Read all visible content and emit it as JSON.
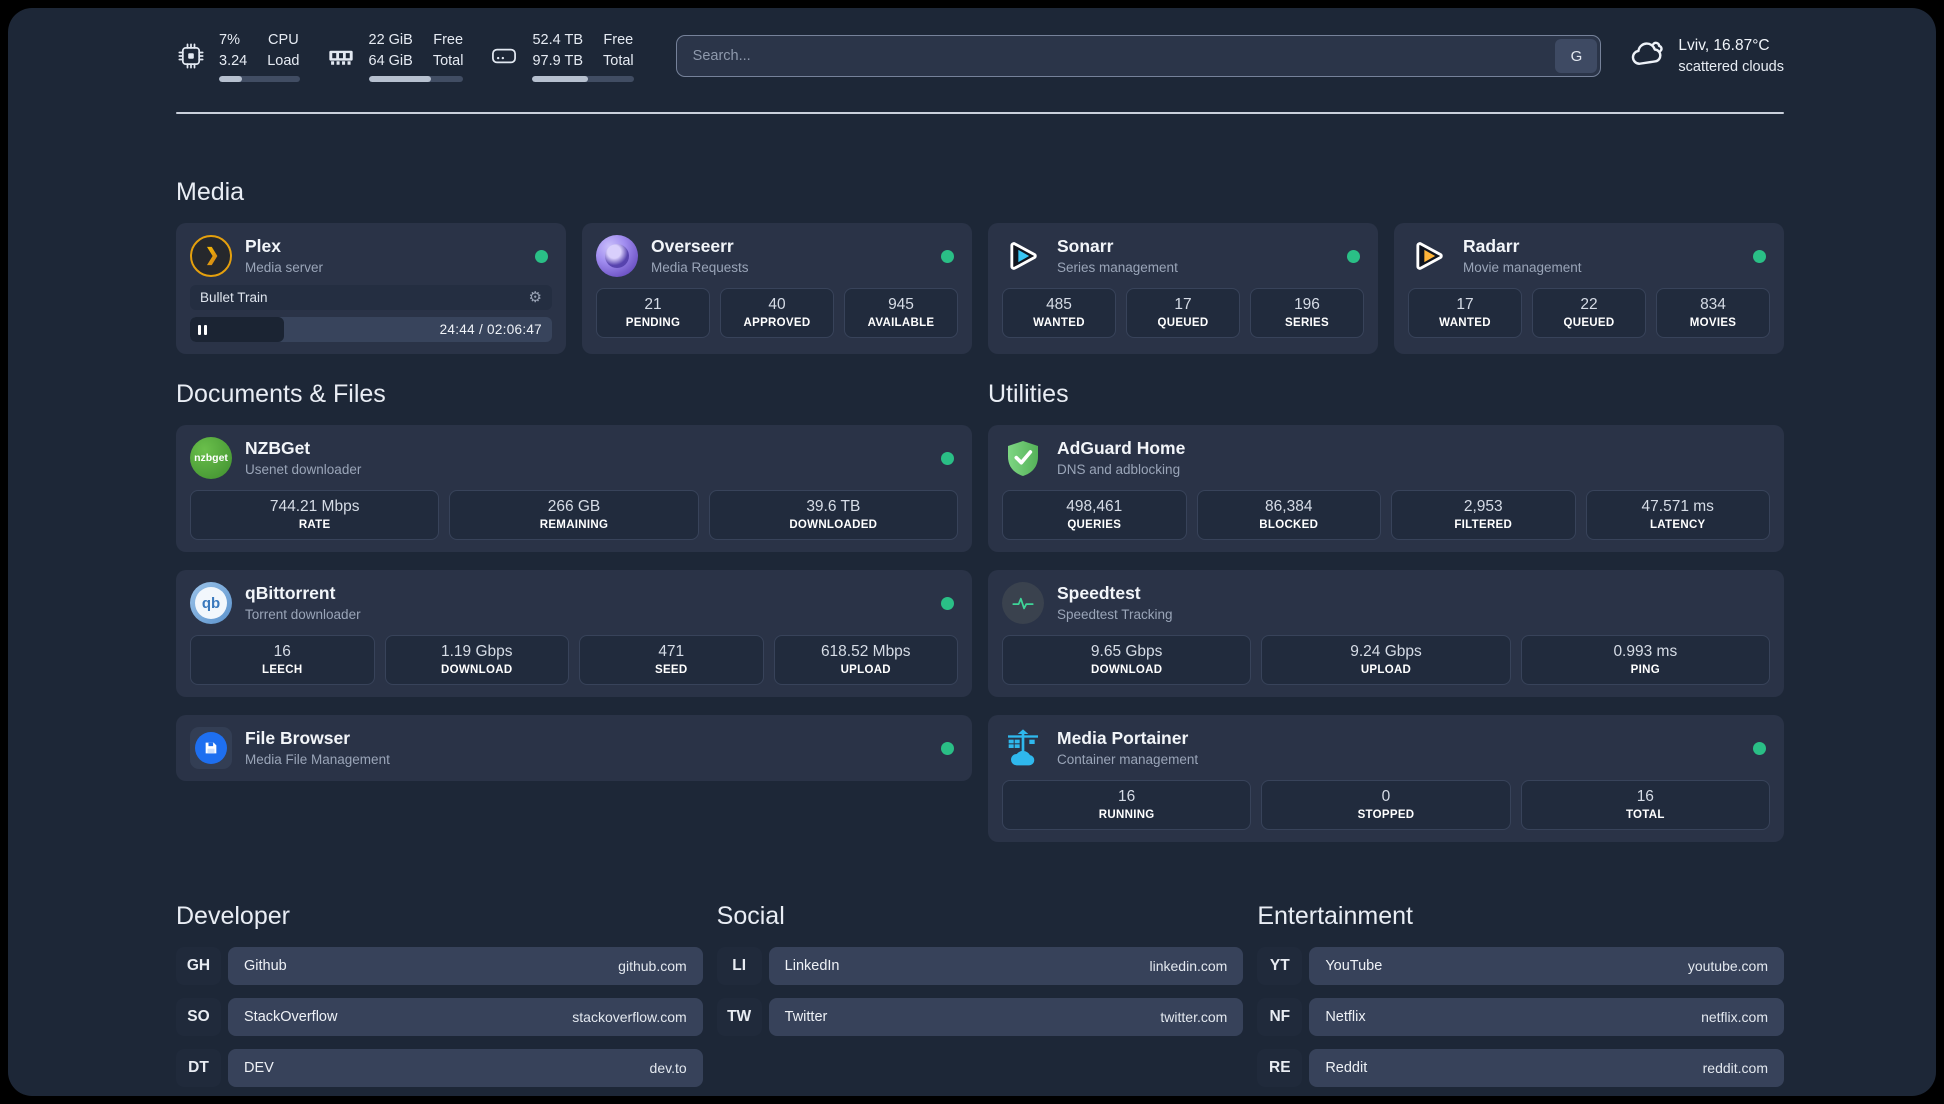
{
  "topbar": {
    "system": [
      {
        "name": "cpu",
        "value_top": "7%",
        "value_bottom": "3.24",
        "label_top": "CPU",
        "label_bottom": "Load",
        "progress": 28
      },
      {
        "name": "memory",
        "value_top": "22 GiB",
        "value_bottom": "64 GiB",
        "label_top": "Free",
        "label_bottom": "Total",
        "progress": 66
      },
      {
        "name": "storage",
        "value_top": "52.4 TB",
        "value_bottom": "97.9 TB",
        "label_top": "Free",
        "label_bottom": "Total",
        "progress": 55
      }
    ],
    "search": {
      "placeholder": "Search...",
      "button_label": "G"
    },
    "weather": {
      "location": "Lviv, 16.87°C",
      "condition": "scattered clouds"
    }
  },
  "sections": {
    "media": {
      "title": "Media",
      "plex": {
        "title": "Plex",
        "subtitle": "Media server",
        "online": true,
        "now_playing": "Bullet Train",
        "progress_pct": 26,
        "time": "24:44 / 02:06:47"
      },
      "overseerr": {
        "title": "Overseerr",
        "subtitle": "Media Requests",
        "online": true,
        "stats": [
          {
            "value": "21",
            "label": "PENDING"
          },
          {
            "value": "40",
            "label": "APPROVED"
          },
          {
            "value": "945",
            "label": "AVAILABLE"
          }
        ]
      },
      "sonarr": {
        "title": "Sonarr",
        "subtitle": "Series management",
        "online": true,
        "stats": [
          {
            "value": "485",
            "label": "WANTED"
          },
          {
            "value": "17",
            "label": "QUEUED"
          },
          {
            "value": "196",
            "label": "SERIES"
          }
        ]
      },
      "radarr": {
        "title": "Radarr",
        "subtitle": "Movie management",
        "online": true,
        "stats": [
          {
            "value": "17",
            "label": "WANTED"
          },
          {
            "value": "22",
            "label": "QUEUED"
          },
          {
            "value": "834",
            "label": "MOVIES"
          }
        ]
      }
    },
    "documents": {
      "title": "Documents & Files",
      "nzbget": {
        "title": "NZBGet",
        "subtitle": "Usenet downloader",
        "online": true,
        "icon_text": "nzbget",
        "stats": [
          {
            "value": "744.21 Mbps",
            "label": "RATE"
          },
          {
            "value": "266 GB",
            "label": "REMAINING"
          },
          {
            "value": "39.6 TB",
            "label": "DOWNLOADED"
          }
        ]
      },
      "qbittorrent": {
        "title": "qBittorrent",
        "subtitle": "Torrent downloader",
        "online": true,
        "icon_text": "qb",
        "stats": [
          {
            "value": "16",
            "label": "LEECH"
          },
          {
            "value": "1.19 Gbps",
            "label": "DOWNLOAD"
          },
          {
            "value": "471",
            "label": "SEED"
          },
          {
            "value": "618.52 Mbps",
            "label": "UPLOAD"
          }
        ]
      },
      "filebrowser": {
        "title": "File Browser",
        "subtitle": "Media File Management",
        "online": true
      }
    },
    "utilities": {
      "title": "Utilities",
      "adguard": {
        "title": "AdGuard Home",
        "subtitle": "DNS and adblocking",
        "online": false,
        "stats": [
          {
            "value": "498,461",
            "label": "QUERIES"
          },
          {
            "value": "86,384",
            "label": "BLOCKED"
          },
          {
            "value": "2,953",
            "label": "FILTERED"
          },
          {
            "value": "47.571 ms",
            "label": "LATENCY"
          }
        ]
      },
      "speedtest": {
        "title": "Speedtest",
        "subtitle": "Speedtest Tracking",
        "online": false,
        "stats": [
          {
            "value": "9.65 Gbps",
            "label": "DOWNLOAD"
          },
          {
            "value": "9.24 Gbps",
            "label": "UPLOAD"
          },
          {
            "value": "0.993 ms",
            "label": "PING"
          }
        ]
      },
      "portainer": {
        "title": "Media Portainer",
        "subtitle": "Container management",
        "online": true,
        "stats": [
          {
            "value": "16",
            "label": "RUNNING"
          },
          {
            "value": "0",
            "label": "STOPPED"
          },
          {
            "value": "16",
            "label": "TOTAL"
          }
        ]
      }
    },
    "bookmarks": {
      "developer": {
        "title": "Developer",
        "links": [
          {
            "abbr": "GH",
            "name": "Github",
            "url": "github.com"
          },
          {
            "abbr": "SO",
            "name": "StackOverflow",
            "url": "stackoverflow.com"
          },
          {
            "abbr": "DT",
            "name": "DEV",
            "url": "dev.to"
          }
        ]
      },
      "social": {
        "title": "Social",
        "links": [
          {
            "abbr": "LI",
            "name": "LinkedIn",
            "url": "linkedin.com"
          },
          {
            "abbr": "TW",
            "name": "Twitter",
            "url": "twitter.com"
          }
        ]
      },
      "entertainment": {
        "title": "Entertainment",
        "links": [
          {
            "abbr": "YT",
            "name": "YouTube",
            "url": "youtube.com"
          },
          {
            "abbr": "NF",
            "name": "Netflix",
            "url": "netflix.com"
          },
          {
            "abbr": "RE",
            "name": "Reddit",
            "url": "reddit.com"
          }
        ]
      }
    }
  },
  "colors": {
    "status_online": "#2abf86",
    "accent_blue": "#2fb8ed",
    "plex_gold": "#e5a00d"
  }
}
